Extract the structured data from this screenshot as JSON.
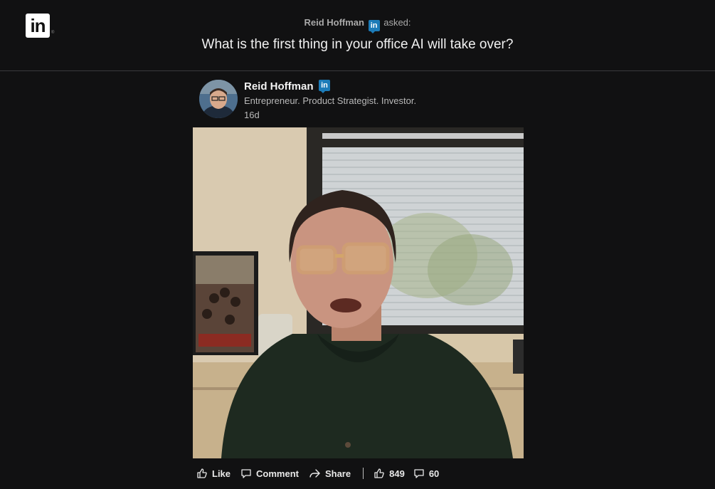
{
  "header": {
    "logo_text": "in",
    "logo_reg": "®",
    "asker_name": "Reid Hoffman",
    "asker_badge": "in",
    "asked_label": "asked:",
    "question": "What is the first thing in your office AI will take over?"
  },
  "post": {
    "author_name": "Reid Hoffman",
    "author_badge": "in",
    "headline": "Entrepreneur. Product Strategist. Investor.",
    "age": "16d"
  },
  "video": {
    "description_icon": "video-frame"
  },
  "actions": {
    "like_label": "Like",
    "comment_label": "Comment",
    "share_label": "Share",
    "like_count": "849",
    "comment_count": "60"
  },
  "colors": {
    "background": "#111112",
    "linkedin_blue": "#1c7bb8",
    "text_primary": "#f1f1f1",
    "text_secondary": "#b9b9b9"
  },
  "icons": [
    "linkedin-logo",
    "linkedin-badge-icon",
    "like-icon",
    "comment-icon",
    "share-icon"
  ]
}
